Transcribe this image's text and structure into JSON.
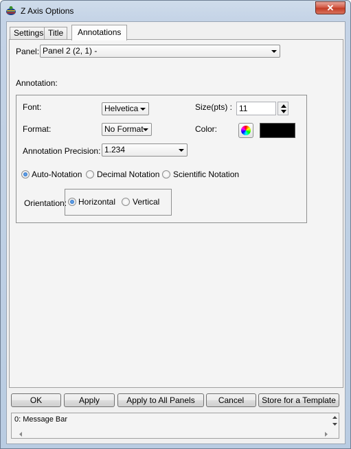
{
  "window": {
    "title": "Z Axis Options",
    "close_symbol": "✕"
  },
  "tabs": [
    {
      "label": "Settings"
    },
    {
      "label": "Title"
    },
    {
      "label": "Annotations"
    }
  ],
  "panel": {
    "label": "Panel:",
    "selected": "Panel 2 (2, 1)  -"
  },
  "annotation": {
    "section_label": "Annotation:",
    "font_label": "Font:",
    "font_value": "Helvetica",
    "size_label": "Size(pts) :",
    "size_value": "11",
    "format_label": "Format:",
    "format_value": "No Format",
    "color_label": "Color:",
    "color_value": "#000000",
    "precision_label": "Annotation Precision:",
    "precision_value": "1.234",
    "notation": [
      {
        "label": "Auto-Notation",
        "checked": true
      },
      {
        "label": "Decimal Notation",
        "checked": false
      },
      {
        "label": "Scientific Notation",
        "checked": false
      }
    ],
    "orientation_label": "Orientation:",
    "orientation": [
      {
        "label": "Horizontal",
        "checked": true
      },
      {
        "label": "Vertical",
        "checked": false
      }
    ]
  },
  "buttons": {
    "ok": "OK",
    "apply": "Apply",
    "apply_all": "Apply to All Panels",
    "cancel": "Cancel",
    "store_template": "Store for a Template"
  },
  "message_bar": {
    "text": "0: Message Bar"
  },
  "icons": {
    "app": "app-icon",
    "close": "close-icon",
    "dropdown": "chevron-down-icon",
    "color_picker": "color-wheel-icon"
  }
}
